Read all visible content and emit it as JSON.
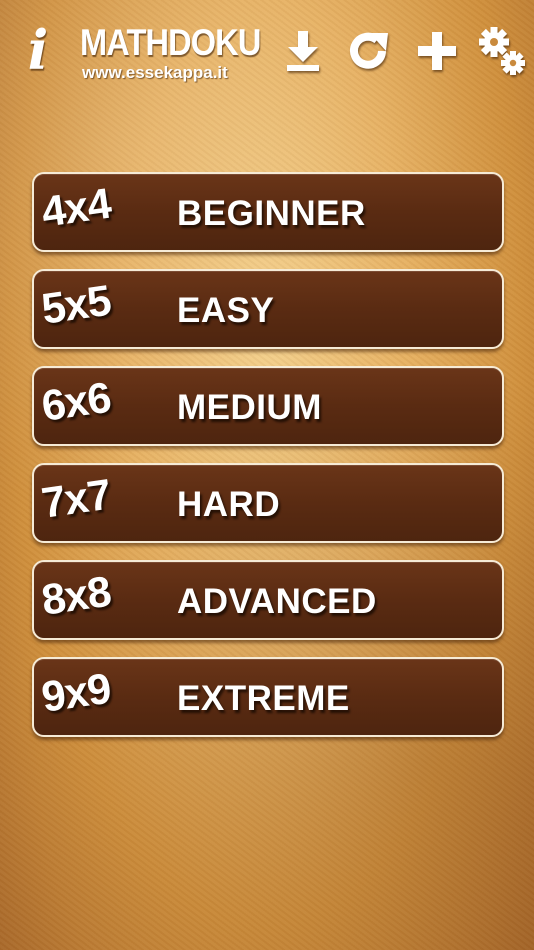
{
  "header": {
    "info_label": "i",
    "title": "MATHDOKU",
    "url": "www.essekappa.it",
    "icons": {
      "info": "info-icon",
      "download": "download-icon",
      "refresh": "refresh-icon",
      "add": "plus-icon",
      "settings": "gears-icon"
    }
  },
  "levels": [
    {
      "size": "4x4",
      "name": "BEGINNER"
    },
    {
      "size": "5x5",
      "name": "EASY"
    },
    {
      "size": "6x6",
      "name": "MEDIUM"
    },
    {
      "size": "7x7",
      "name": "HARD"
    },
    {
      "size": "8x8",
      "name": "ADVANCED"
    },
    {
      "size": "9x9",
      "name": "EXTREME"
    }
  ],
  "colors": {
    "button_fill": "#5a2b12",
    "button_border": "#f6ebd6",
    "text": "#ffffff",
    "background": "#e6b061"
  }
}
